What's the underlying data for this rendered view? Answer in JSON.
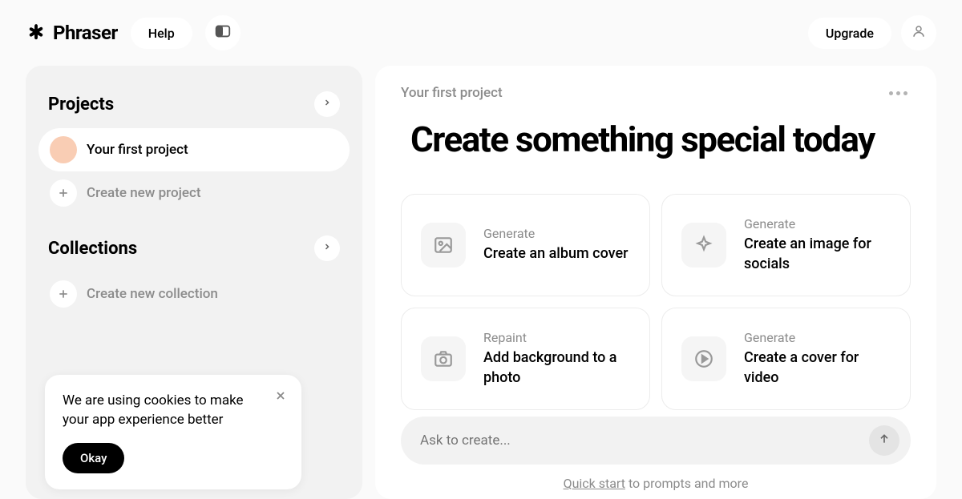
{
  "header": {
    "brand": "Phraser",
    "help_label": "Help",
    "upgrade_label": "Upgrade"
  },
  "sidebar": {
    "projects_title": "Projects",
    "project_item": "Your first project",
    "create_project": "Create new project",
    "collections_title": "Collections",
    "create_collection": "Create new collection"
  },
  "cookie": {
    "text": "We are using cookies to make your app experience better",
    "okay": "Okay"
  },
  "main": {
    "breadcrumb": "Your first project",
    "hero": "Create something special today",
    "cards": [
      {
        "eyebrow": "Generate",
        "title": "Create an album cover",
        "icon": "image-icon"
      },
      {
        "eyebrow": "Generate",
        "title": "Create an image for socials",
        "icon": "sparkle-icon"
      },
      {
        "eyebrow": "Repaint",
        "title": "Add background to a photo",
        "icon": "camera-icon"
      },
      {
        "eyebrow": "Generate",
        "title": "Create a cover for video",
        "icon": "play-icon"
      }
    ],
    "prompt_placeholder": "Ask to create...",
    "footer_link": "Quick start",
    "footer_rest": " to prompts and more"
  }
}
